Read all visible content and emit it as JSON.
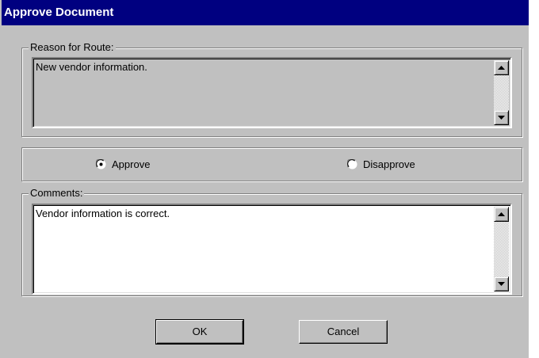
{
  "window": {
    "title": "Approve Document"
  },
  "reason": {
    "label": "Reason for Route:",
    "text": "New vendor information."
  },
  "decision": {
    "approve_label": "Approve",
    "disapprove_label": "Disapprove",
    "selected": "Approve"
  },
  "comments": {
    "label": "Comments:",
    "text": "Vendor information is correct."
  },
  "buttons": {
    "ok": "OK",
    "cancel": "Cancel"
  },
  "icons": {
    "scroll_up": "arrow-up-icon",
    "scroll_down": "arrow-down-icon"
  },
  "colors": {
    "titlebar": "#000080",
    "face": "#c0c0c0",
    "reason_bg": "#c0c0c0",
    "comments_bg": "#ffffff"
  }
}
